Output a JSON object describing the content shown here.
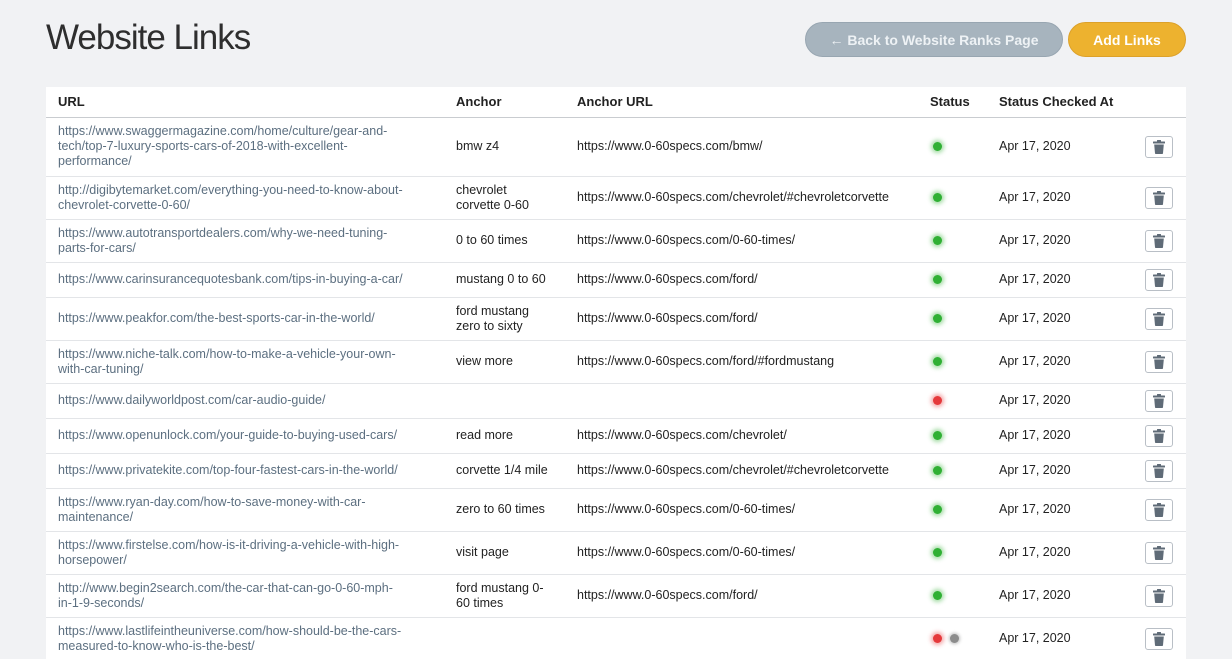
{
  "page": {
    "title": "Website Links",
    "back_button": "← Back to Website Ranks Page",
    "add_button": "Add Links"
  },
  "colors": {
    "background": "#f1f2f4",
    "back_button": "#a7b4be",
    "add_button": "#edb22f",
    "status_ok": "#30b034",
    "status_error": "#e5393b",
    "status_unknown": "#8c8c8c"
  },
  "table": {
    "columns": [
      "URL",
      "Anchor",
      "Anchor URL",
      "Status",
      "Status Checked At"
    ],
    "rows": [
      {
        "url": [
          "https://www.swaggermagazine.com/home/culture/gear-and-",
          "tech/top-7-luxury-sports-cars-of-2018-with-excellent-",
          "performance/"
        ],
        "anchor": "bmw z4",
        "anchor_url": "https://www.0-60specs.com/bmw/",
        "status": [
          "ok"
        ],
        "checked": "Apr 17, 2020"
      },
      {
        "url": [
          "http://digibytemarket.com/everything-you-need-to-know-about-",
          "chevrolet-corvette-0-60/"
        ],
        "anchor": "chevrolet corvette 0-60",
        "anchor_url": "https://www.0-60specs.com/chevrolet/#chevroletcorvette",
        "status": [
          "ok"
        ],
        "checked": "Apr 17, 2020"
      },
      {
        "url": [
          "https://www.autotransportdealers.com/why-we-need-tuning-",
          "parts-for-cars/"
        ],
        "anchor": "0 to 60 times",
        "anchor_url": "https://www.0-60specs.com/0-60-times/",
        "status": [
          "ok"
        ],
        "checked": "Apr 17, 2020"
      },
      {
        "url": [
          "https://www.carinsurancequotesbank.com/tips-in-buying-a-car/"
        ],
        "anchor": "mustang 0 to 60",
        "anchor_url": "https://www.0-60specs.com/ford/",
        "status": [
          "ok"
        ],
        "checked": "Apr 17, 2020"
      },
      {
        "url": [
          "https://www.peakfor.com/the-best-sports-car-in-the-world/"
        ],
        "anchor": "ford mustang zero to sixty",
        "anchor_url": "https://www.0-60specs.com/ford/",
        "status": [
          "ok"
        ],
        "checked": "Apr 17, 2020"
      },
      {
        "url": [
          "https://www.niche-talk.com/how-to-make-a-vehicle-your-own-",
          "with-car-tuning/"
        ],
        "anchor": "view more",
        "anchor_url": "https://www.0-60specs.com/ford/#fordmustang",
        "status": [
          "ok"
        ],
        "checked": "Apr 17, 2020"
      },
      {
        "url": [
          "https://www.dailyworldpost.com/car-audio-guide/"
        ],
        "anchor": "",
        "anchor_url": "",
        "status": [
          "error"
        ],
        "checked": "Apr 17, 2020"
      },
      {
        "url": [
          "https://www.openunlock.com/your-guide-to-buying-used-cars/"
        ],
        "anchor": "read more",
        "anchor_url": "https://www.0-60specs.com/chevrolet/",
        "status": [
          "ok"
        ],
        "checked": "Apr 17, 2020"
      },
      {
        "url": [
          "https://www.privatekite.com/top-four-fastest-cars-in-the-world/"
        ],
        "anchor": "corvette 1/4 mile",
        "anchor_url": "https://www.0-60specs.com/chevrolet/#chevroletcorvette",
        "status": [
          "ok"
        ],
        "checked": "Apr 17, 2020"
      },
      {
        "url": [
          "https://www.ryan-day.com/how-to-save-money-with-car-",
          "maintenance/"
        ],
        "anchor": "zero to 60 times",
        "anchor_url": "https://www.0-60specs.com/0-60-times/",
        "status": [
          "ok"
        ],
        "checked": "Apr 17, 2020"
      },
      {
        "url": [
          "https://www.firstelse.com/how-is-it-driving-a-vehicle-with-high-",
          "horsepower/"
        ],
        "anchor": "visit page",
        "anchor_url": "https://www.0-60specs.com/0-60-times/",
        "status": [
          "ok"
        ],
        "checked": "Apr 17, 2020"
      },
      {
        "url": [
          "http://www.begin2search.com/the-car-that-can-go-0-60-mph-",
          "in-1-9-seconds/"
        ],
        "anchor": "ford mustang 0-60 times",
        "anchor_url": "https://www.0-60specs.com/ford/",
        "status": [
          "ok"
        ],
        "checked": "Apr 17, 2020"
      },
      {
        "url": [
          "https://www.lastlifeintheuniverse.com/how-should-be-the-cars-",
          "measured-to-know-who-is-the-best/"
        ],
        "anchor": "",
        "anchor_url": "",
        "status": [
          "error",
          "unknown"
        ],
        "checked": "Apr 17, 2020"
      }
    ]
  },
  "icons": {
    "delete": "trash-icon",
    "back": "arrow-left-icon"
  }
}
